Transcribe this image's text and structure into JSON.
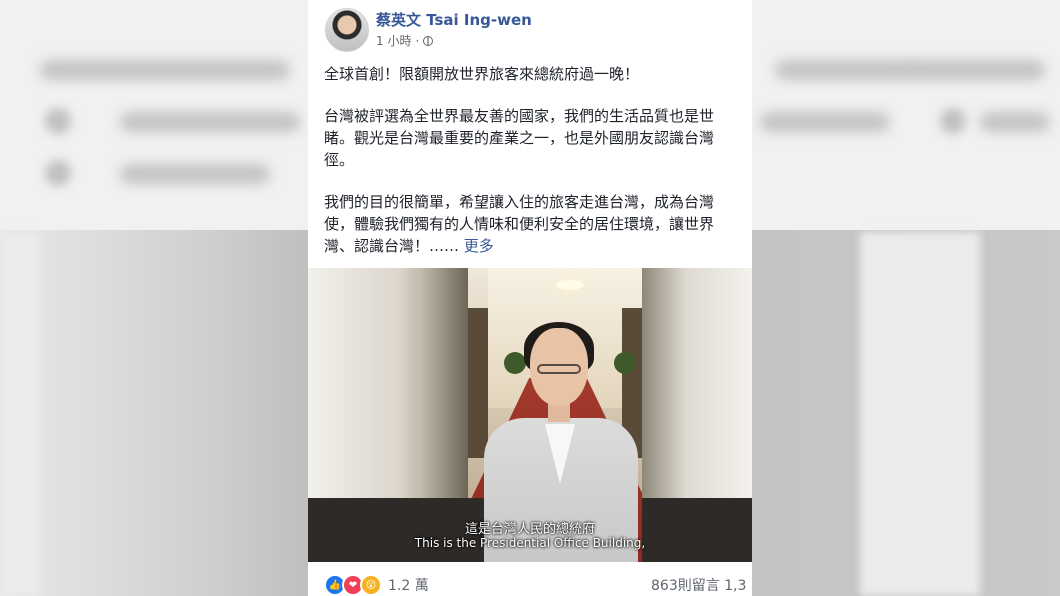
{
  "post": {
    "author": "蔡英文 Tsai Ing-wen",
    "time": "1 小時",
    "separator": "·",
    "lines": [
      "全球首創！限額開放世界旅客來總統府過一晚！",
      "台灣被評選為全世界最友善的國家，我們的生活品質也是世",
      "睹。觀光是台灣最重要的產業之一，也是外國朋友認識台灣",
      "徑。",
      "我們的目的很簡單，希望讓入住的旅客走進台灣，成為台灣",
      "使，體驗我們獨有的人情味和便利安全的居住環境，讓世界",
      "灣、認識台灣！……"
    ],
    "more_label": "更多",
    "video": {
      "subtitle_zh": "這是台灣人民的總統府",
      "subtitle_en": "This is the Presidential Office Building,"
    },
    "reactions": {
      "icons": [
        "like-icon",
        "love-icon",
        "wow-icon"
      ],
      "count": "1.2 萬"
    },
    "comments": "863則留言",
    "shares": "1,3"
  },
  "colors": {
    "link": "#385898",
    "text": "#1d2129",
    "meta": "#616770",
    "like": "#1877f2",
    "love": "#f33e58",
    "wow": "#f7b125"
  }
}
